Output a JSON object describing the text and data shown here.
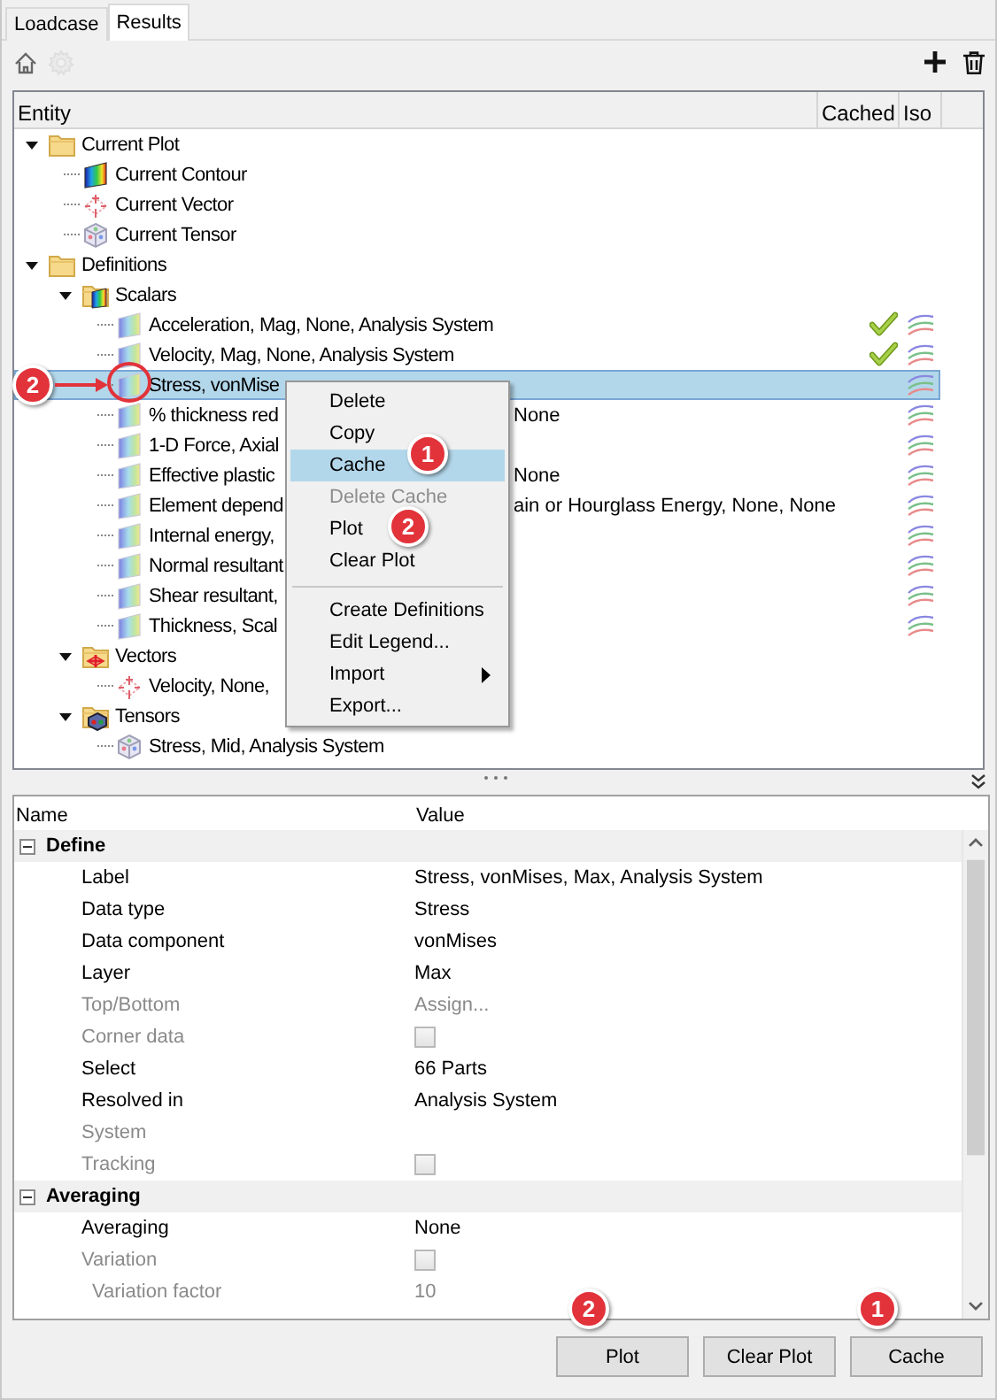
{
  "tabs": [
    {
      "label": "Loadcase",
      "selected": false
    },
    {
      "label": "Results",
      "selected": true
    }
  ],
  "toolbar": {
    "home_disabled": false,
    "settings_disabled": true
  },
  "tree": {
    "columns": [
      "Entity",
      "Cached",
      "Iso"
    ],
    "items": [
      {
        "label": "Current Plot",
        "kind": "folder",
        "expanded": true,
        "selected": false,
        "children": [
          {
            "label": "Current Contour",
            "kind": "contour",
            "selected": false
          },
          {
            "label": "Current Vector",
            "kind": "vector",
            "selected": false
          },
          {
            "label": "Current Tensor",
            "kind": "tensor",
            "selected": false
          }
        ]
      },
      {
        "label": "Definitions",
        "kind": "folder",
        "expanded": true,
        "selected": false,
        "children": [
          {
            "label": "Scalars",
            "kind": "scalar-folder",
            "expanded": true,
            "selected": false,
            "children": [
              {
                "label": "Acceleration, Mag, None, Analysis System",
                "kind": "scalar",
                "cached": true,
                "selected": false
              },
              {
                "label": "Velocity, Mag, None, Analysis System",
                "kind": "scalar",
                "cached": true,
                "selected": false
              },
              {
                "label": "Stress, vonMise",
                "kind": "scalar",
                "cached": false,
                "selected": true
              },
              {
                "label": "% thickness red",
                "label_right": "None",
                "kind": "scalar",
                "cached": false,
                "selected": false
              },
              {
                "label": "1-D Force, Axial",
                "kind": "scalar",
                "cached": false,
                "selected": false
              },
              {
                "label": "Effective plastic",
                "label_right": "None",
                "kind": "scalar",
                "cached": false,
                "selected": false
              },
              {
                "label": "Element depend",
                "label_right": "ain or Hourglass Energy, None, None",
                "kind": "scalar",
                "cached": false,
                "selected": false
              },
              {
                "label": "Internal energy,",
                "kind": "scalar",
                "cached": false,
                "selected": false
              },
              {
                "label": "Normal resultant",
                "kind": "scalar",
                "cached": false,
                "selected": false
              },
              {
                "label": "Shear resultant,",
                "kind": "scalar",
                "cached": false,
                "selected": false
              },
              {
                "label": "Thickness, Scal",
                "kind": "scalar",
                "cached": false,
                "selected": false
              }
            ]
          },
          {
            "label": "Vectors",
            "kind": "vector-folder",
            "expanded": true,
            "selected": false,
            "children": [
              {
                "label": "Velocity, None,",
                "kind": "vector",
                "selected": false
              }
            ]
          },
          {
            "label": "Tensors",
            "kind": "tensor-folder",
            "expanded": true,
            "selected": false,
            "children": [
              {
                "label": "Stress, Mid, Analysis System",
                "kind": "tensor",
                "selected": false
              }
            ]
          }
        ]
      }
    ]
  },
  "context_menu": [
    {
      "label": "Delete",
      "kind": "item",
      "selected": false,
      "disabled": false
    },
    {
      "label": "Copy",
      "kind": "item",
      "selected": false,
      "disabled": false
    },
    {
      "label": "Cache",
      "kind": "item",
      "selected": true,
      "disabled": false
    },
    {
      "label": "Delete Cache",
      "kind": "item",
      "selected": false,
      "disabled": true
    },
    {
      "label": "Plot",
      "kind": "item",
      "selected": false,
      "disabled": false
    },
    {
      "label": "Clear Plot",
      "kind": "item",
      "selected": false,
      "disabled": false
    },
    {
      "kind": "separator"
    },
    {
      "label": "Create Definitions",
      "kind": "item",
      "selected": false,
      "disabled": false
    },
    {
      "label": "Edit Legend...",
      "kind": "item",
      "selected": false,
      "disabled": false
    },
    {
      "label": "Import",
      "kind": "submenu",
      "selected": false,
      "disabled": false
    },
    {
      "label": "Export...",
      "kind": "item",
      "selected": false,
      "disabled": false
    }
  ],
  "properties": {
    "columns": [
      "Name",
      "Value"
    ],
    "groups": [
      {
        "label": "Define",
        "expanded": true,
        "rows": [
          {
            "name": "Label",
            "kind": "text",
            "value": "Stress, vonMises, Max, Analysis System",
            "disabled": false
          },
          {
            "name": "Data type",
            "kind": "text",
            "value": "Stress",
            "disabled": false
          },
          {
            "name": "Data component",
            "kind": "text",
            "value": "vonMises",
            "disabled": false
          },
          {
            "name": "Layer",
            "kind": "text",
            "value": "Max",
            "disabled": false
          },
          {
            "name": "Top/Bottom",
            "kind": "text",
            "value": "Assign...",
            "disabled": true
          },
          {
            "name": "Corner data",
            "kind": "checkbox",
            "checked": false,
            "disabled": true
          },
          {
            "name": "Select",
            "kind": "text",
            "value": "66 Parts",
            "disabled": false
          },
          {
            "name": "Resolved in",
            "kind": "text",
            "value": "Analysis System",
            "disabled": false
          },
          {
            "name": "System",
            "kind": "text",
            "disabled": true
          },
          {
            "name": "Tracking",
            "kind": "checkbox",
            "checked": false,
            "disabled": true
          }
        ]
      },
      {
        "label": "Averaging",
        "expanded": true,
        "rows": [
          {
            "name": "Averaging",
            "kind": "text",
            "value": "None",
            "disabled": false
          },
          {
            "name": "Variation",
            "kind": "checkbox",
            "checked": false,
            "disabled": true,
            "children": [
              {
                "name": "Variation factor",
                "kind": "text",
                "value": "10",
                "disabled": true
              }
            ]
          }
        ]
      }
    ]
  },
  "buttons": [
    {
      "label": "Plot"
    },
    {
      "label": "Clear Plot"
    },
    {
      "label": "Cache"
    }
  ],
  "annotations": [
    {
      "label": "2",
      "kind": "arrow-callout"
    },
    {
      "label": "1",
      "kind": "badge"
    },
    {
      "label": "2",
      "kind": "badge"
    },
    {
      "label": "2",
      "kind": "badge"
    },
    {
      "label": "1",
      "kind": "badge"
    }
  ]
}
